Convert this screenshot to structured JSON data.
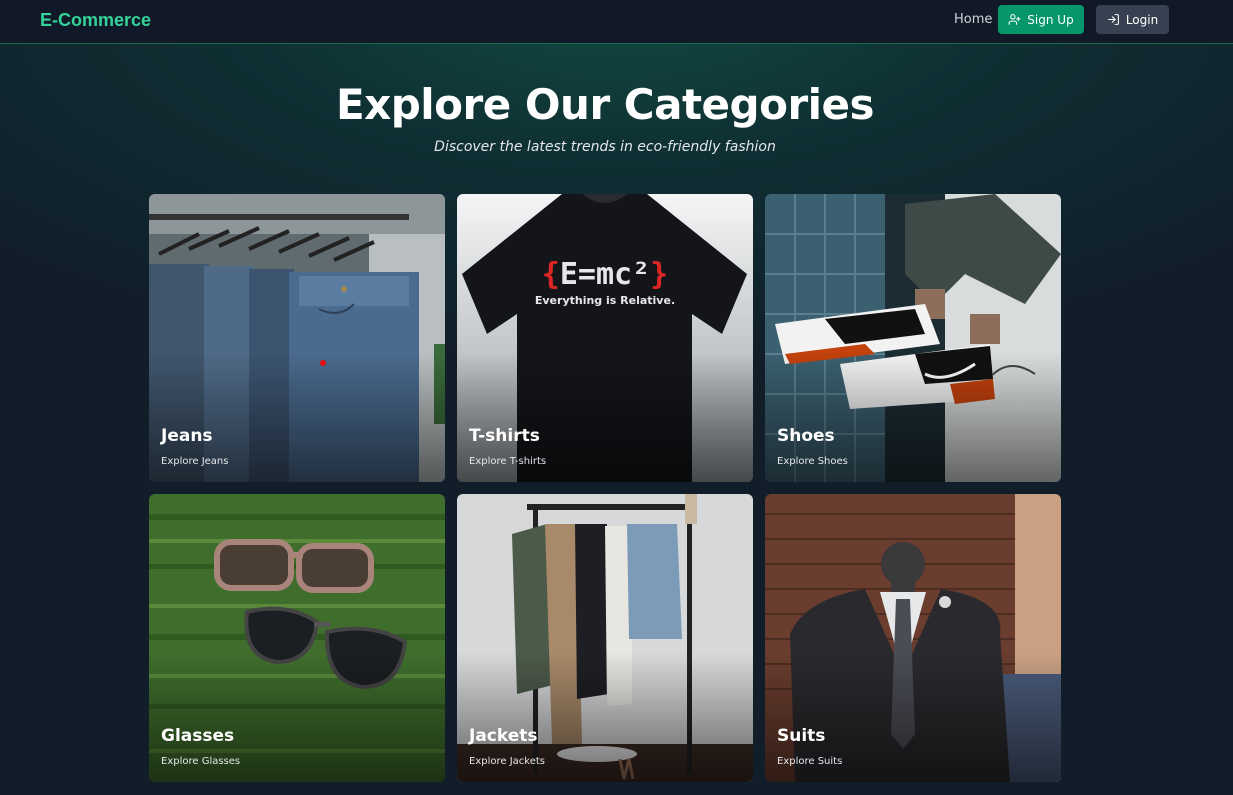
{
  "nav": {
    "brand": "E-Commerce",
    "home": "Home",
    "signup": "Sign Up",
    "login": "Login"
  },
  "hero": {
    "title": "Explore Our Categories",
    "subtitle": "Discover the latest trends in eco-friendly fashion"
  },
  "categories": [
    {
      "title": "Jeans",
      "subtitle": "Explore Jeans"
    },
    {
      "title": "T-shirts",
      "subtitle": "Explore T-shirts",
      "shirt_print": "E = mc²",
      "shirt_tagline": "Everything is Relative."
    },
    {
      "title": "Shoes",
      "subtitle": "Explore Shoes"
    },
    {
      "title": "Glasses",
      "subtitle": "Explore Glasses"
    },
    {
      "title": "Jackets",
      "subtitle": "Explore Jackets"
    },
    {
      "title": "Suits",
      "subtitle": "Explore Suits"
    }
  ],
  "colors": {
    "brand": "#34d399",
    "signup_bg": "#059669",
    "login_bg": "#374151",
    "navbar_bg": "#111827"
  }
}
